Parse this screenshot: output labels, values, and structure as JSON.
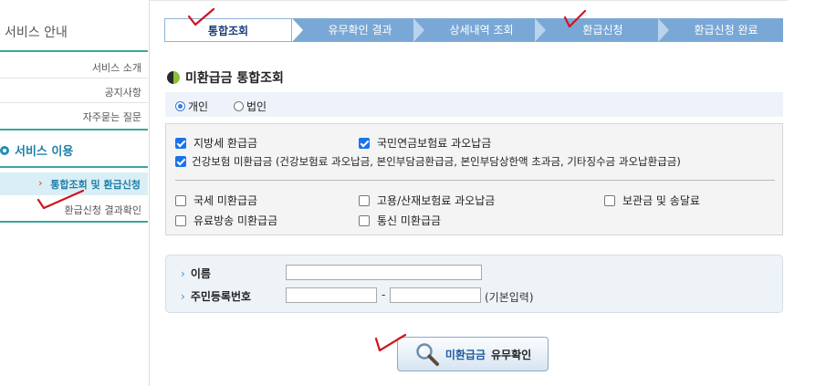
{
  "sidebar": {
    "title": "서비스 안내",
    "items": [
      "서비스 소개",
      "공지사항",
      "자주묻는 질문"
    ],
    "use_title": "서비스 이용",
    "sub_items": [
      {
        "label": "통합조회 및 환급신청",
        "active": true
      },
      {
        "label": "환급신청 결과확인",
        "active": false
      }
    ],
    "active_marker": "›"
  },
  "steps": [
    "통합조회",
    "유무확인 결과",
    "상세내역 조회",
    "환급신청",
    "환급신청 완료"
  ],
  "section_title": "미환급금 통합조회",
  "radio": {
    "options": [
      "개인",
      "법인"
    ],
    "selected": "개인"
  },
  "checkboxes": {
    "group1": [
      {
        "label": "지방세 환급금",
        "checked": true
      },
      {
        "label": "국민연금보험료 과오납금",
        "checked": true
      },
      {
        "label": "건강보험 미환급금 (건강보험료 과오납금, 본인부담금환급금, 본인부담상한액 초과금, 기타징수금 과오납환급금)",
        "checked": true
      }
    ],
    "group2": [
      {
        "label": "국세 미환급금",
        "checked": false
      },
      {
        "label": "고용/산재보험료 과오납금",
        "checked": false
      },
      {
        "label": "보관금 및 송달료",
        "checked": false
      },
      {
        "label": "유료방송 미환급금",
        "checked": false
      },
      {
        "label": "통신 미환급금",
        "checked": false
      }
    ]
  },
  "form": {
    "name_label": "이름",
    "name_value": "",
    "rrn_label": "주민등록번호",
    "rrn_front": "",
    "rrn_back": "",
    "rrn_separator": "-",
    "rrn_note": "(기본입력)",
    "chevron": "›"
  },
  "submit": {
    "label_colored": "미환급금",
    "label_plain": "유무확인"
  },
  "colors": {
    "accent": "#1f7fa8",
    "step_active": "#ffffff",
    "step_inactive": "#7aa8d6",
    "annotation": "#d0141e"
  }
}
